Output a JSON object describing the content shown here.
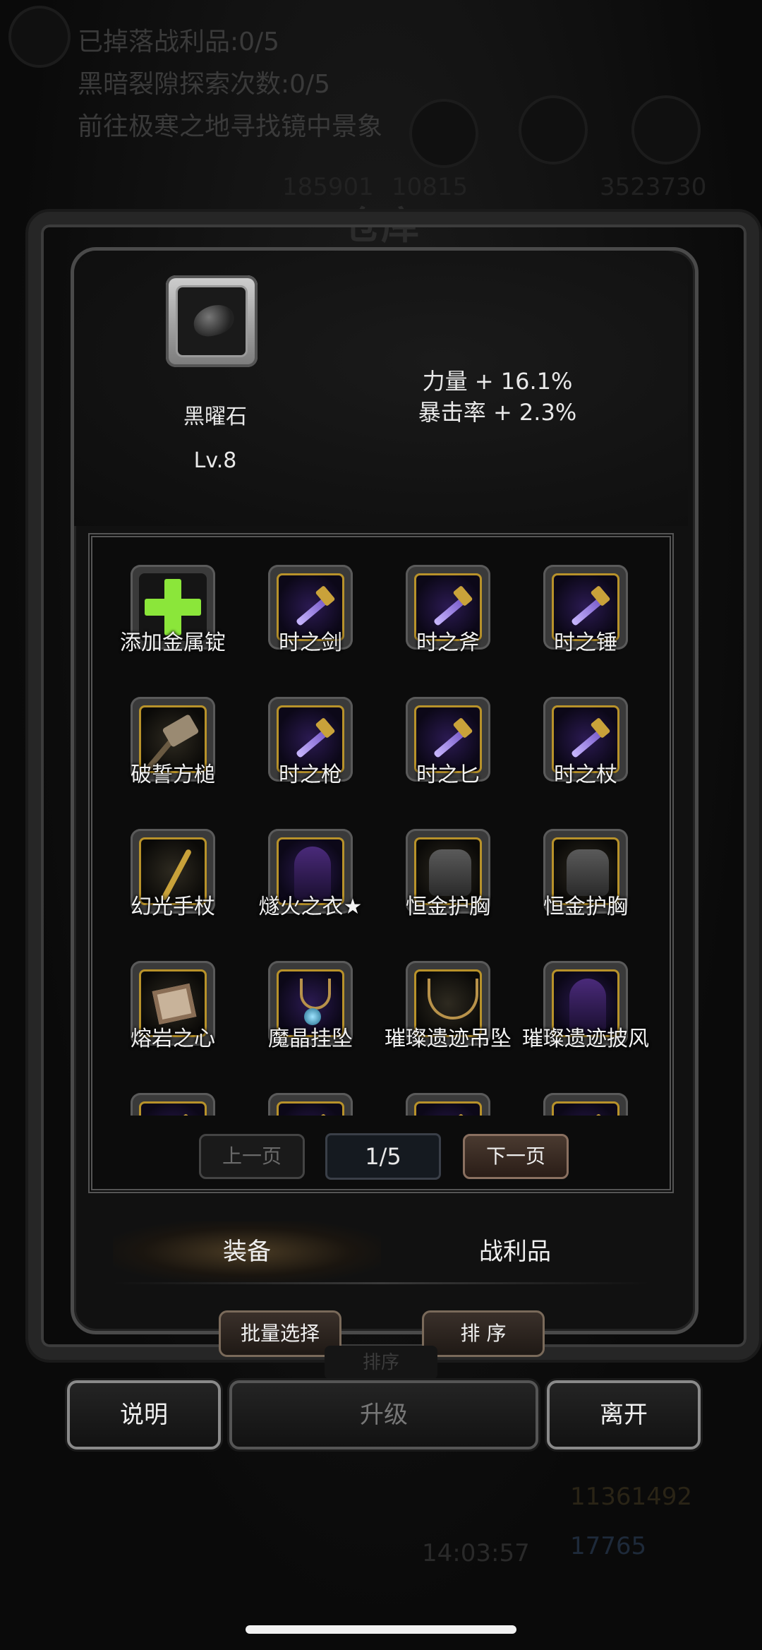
{
  "background": {
    "quest_lines": [
      "已掉落战利品:0/5",
      "黑暗裂隙探索次数:0/5",
      "前往极寒之地寻找镜中景象"
    ],
    "title": "仓库",
    "numbers": [
      "185901",
      "10815",
      "3523730"
    ],
    "currency": [
      "11361492",
      "17765"
    ],
    "time": "14:03:57",
    "sort_ghost": "排序"
  },
  "selected_item": {
    "name": "黑曜石",
    "level": "Lv.8",
    "icon": "obsidian-stone-icon",
    "stats": [
      "力量 + 16.1%",
      "暴击率 + 2.3%"
    ]
  },
  "grid": {
    "items": [
      {
        "label": "添加金属锭",
        "icon": "add-plus-icon",
        "art": "plus"
      },
      {
        "label": "时之剑",
        "icon": "sword-icon",
        "art": "blade"
      },
      {
        "label": "时之斧",
        "icon": "axe-icon",
        "art": "blade"
      },
      {
        "label": "时之锤",
        "icon": "mace-icon",
        "art": "blade"
      },
      {
        "label": "破誓方槌",
        "icon": "hammer-icon",
        "art": "hammer"
      },
      {
        "label": "时之枪",
        "icon": "spear-icon",
        "art": "blade"
      },
      {
        "label": "时之匕",
        "icon": "dagger-icon",
        "art": "blade"
      },
      {
        "label": "时之杖",
        "icon": "scepter-icon",
        "art": "blade"
      },
      {
        "label": "幻光手杖",
        "icon": "staff-icon",
        "art": "staff"
      },
      {
        "label": "燧火之衣★",
        "icon": "robe-icon",
        "art": "robe"
      },
      {
        "label": "恒金护胸",
        "icon": "chest-armor-icon",
        "art": "armor"
      },
      {
        "label": "恒金护胸",
        "icon": "chest-armor-icon",
        "art": "armor"
      },
      {
        "label": "熔岩之心",
        "icon": "lava-heart-icon",
        "art": "square"
      },
      {
        "label": "魔晶挂坠",
        "icon": "crystal-pendant-icon",
        "art": "gem"
      },
      {
        "label": "璀璨遗迹吊坠",
        "icon": "necklace-icon",
        "art": "chain"
      },
      {
        "label": "璀璨遗迹披风",
        "icon": "cloak-icon",
        "art": "robe"
      },
      {
        "label": "",
        "icon": "item-icon",
        "art": "blade"
      },
      {
        "label": "",
        "icon": "item-icon",
        "art": "blade"
      },
      {
        "label": "",
        "icon": "item-icon",
        "art": "blade"
      },
      {
        "label": "",
        "icon": "item-icon",
        "art": "blade"
      }
    ]
  },
  "pagination": {
    "prev": "上一页",
    "page": "1/5",
    "next": "下一页"
  },
  "tabs": {
    "equipment": "装备",
    "loot": "战利品"
  },
  "actions": {
    "batch_select": "批量选择",
    "sort": "排 序"
  },
  "footer": {
    "explain": "说明",
    "upgrade": "升级",
    "leave": "离开"
  },
  "colors": {
    "gold_border": "#b8922a",
    "plus_green": "#8be63a",
    "panel_bg": "#111111"
  }
}
